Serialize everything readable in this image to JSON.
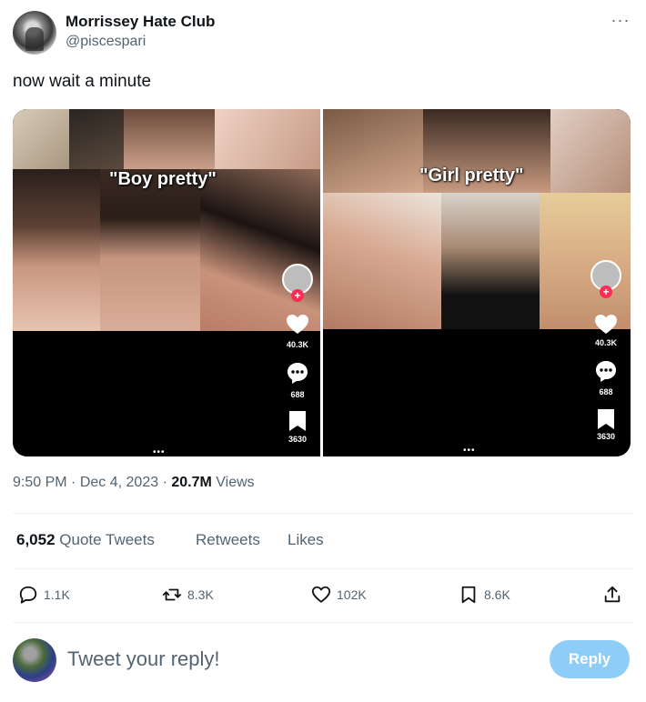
{
  "author": {
    "name": "Morrissey Hate Club",
    "handle": "@piscespari",
    "more_icon": "more-horizontal-icon"
  },
  "tweet": {
    "text": "now wait a minute",
    "time": "9:50 PM",
    "date": "Dec 4, 2023",
    "views_count": "20.7M",
    "views_label": "Views"
  },
  "media": {
    "left": {
      "caption": "\"Boy pretty\"",
      "likes": "40.3K",
      "comments": "688",
      "saves": "3630",
      "dots": "•••"
    },
    "right": {
      "caption": "\"Girl pretty\"",
      "likes": "40.3K",
      "comments": "688",
      "saves": "3630",
      "dots": "•••"
    }
  },
  "stats": {
    "quote_count": "6,052",
    "quote_label": "Quote Tweets",
    "retweets_label": "Retweets",
    "likes_label": "Likes"
  },
  "actions": {
    "replies": "1.1K",
    "retweets": "8.3K",
    "likes": "102K",
    "bookmarks": "8.6K"
  },
  "reply": {
    "placeholder": "Tweet your reply!",
    "button_label": "Reply"
  },
  "colors": {
    "text": "#0f1419",
    "secondary": "#536471",
    "reply_button": "#8ecdf8",
    "tiktok_plus": "#fe2c55"
  }
}
